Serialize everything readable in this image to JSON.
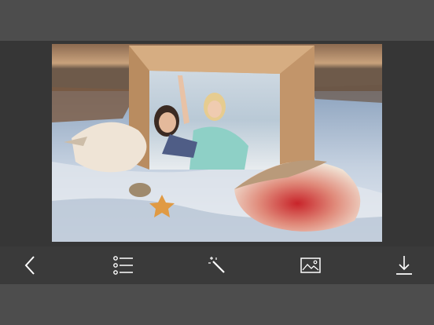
{
  "photo": {
    "description_icon": "photo-collage"
  },
  "toolbar": {
    "items": [
      {
        "name": "back-button",
        "icon": "chevron-left-icon"
      },
      {
        "name": "frames-list-button",
        "icon": "list-icon"
      },
      {
        "name": "effects-button",
        "icon": "magic-wand-icon"
      },
      {
        "name": "background-button",
        "icon": "image-icon"
      },
      {
        "name": "save-button",
        "icon": "download-icon"
      }
    ]
  },
  "colors": {
    "toolbar_bg": "#3a3a3a",
    "canvas_bg": "#363636",
    "chrome_bg": "#4d4d4d",
    "icon": "#ffffff"
  }
}
